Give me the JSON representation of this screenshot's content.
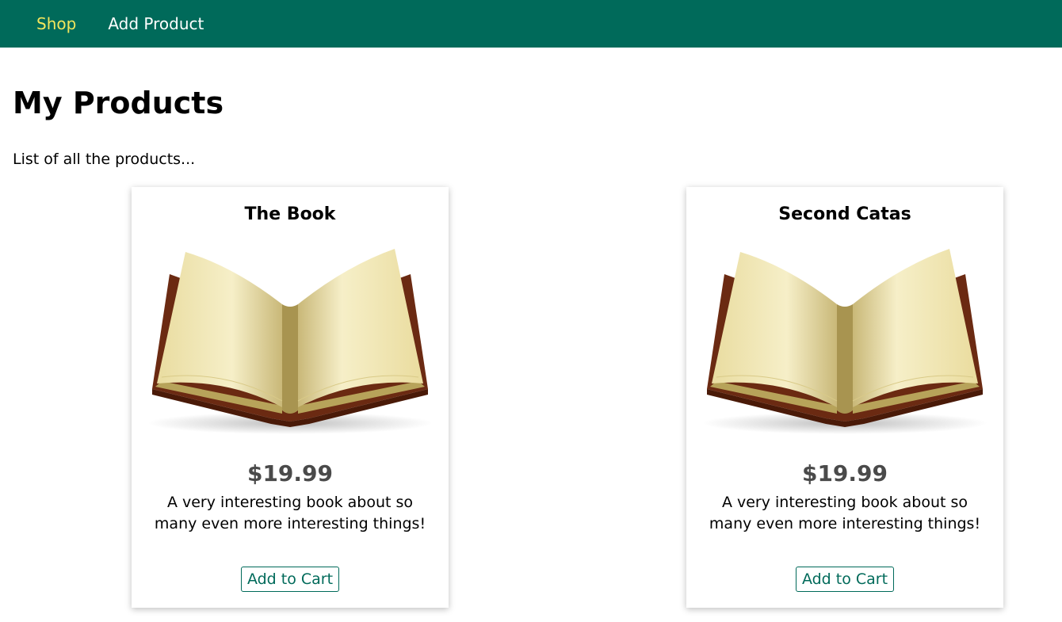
{
  "header": {
    "nav": [
      {
        "label": "Shop",
        "active": true
      },
      {
        "label": "Add Product",
        "active": false
      }
    ],
    "background_color": "#006a5a",
    "active_color": "#f3e65c"
  },
  "main": {
    "title": "My Products",
    "subtitle": "List of all the products..."
  },
  "products": [
    {
      "title": "The Book",
      "image_icon": "open-book-image",
      "price": "$19.99",
      "description": "A very interesting book about so many even more interesting things!",
      "button_label": "Add to Cart"
    },
    {
      "title": "Second Catas",
      "image_icon": "open-book-image",
      "price": "$19.99",
      "description": "A very interesting book about so many even more interesting things!",
      "button_label": "Add to Cart"
    }
  ]
}
